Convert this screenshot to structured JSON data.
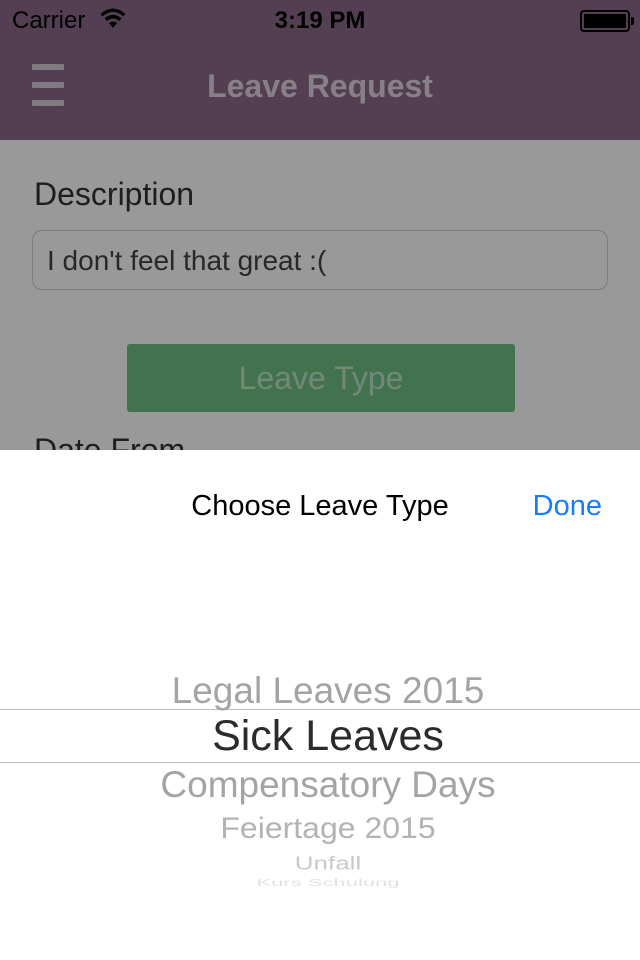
{
  "status_bar": {
    "carrier": "Carrier",
    "time": "3:19 PM",
    "wifi_icon": "wifi-icon",
    "battery_icon": "battery-full-icon",
    "battery_level": 1.0
  },
  "nav": {
    "title": "Leave Request",
    "menu_icon": "hamburger-menu-icon",
    "background_color": "#8a6a87"
  },
  "form": {
    "description_label": "Description",
    "description_value": "I don't feel that great :(",
    "leave_type_button": "Leave Type",
    "leave_type_button_color": "#6fbf82",
    "date_from_label": "Date From"
  },
  "picker": {
    "title": "Choose Leave Type",
    "done_label": "Done",
    "done_color": "#157efb",
    "selected_index": 1,
    "items": [
      "Legal Leaves 2015",
      "Sick Leaves",
      "Compensatory Days",
      "Feiertage 2015",
      "Unfall",
      "Kurs Schulung"
    ]
  }
}
